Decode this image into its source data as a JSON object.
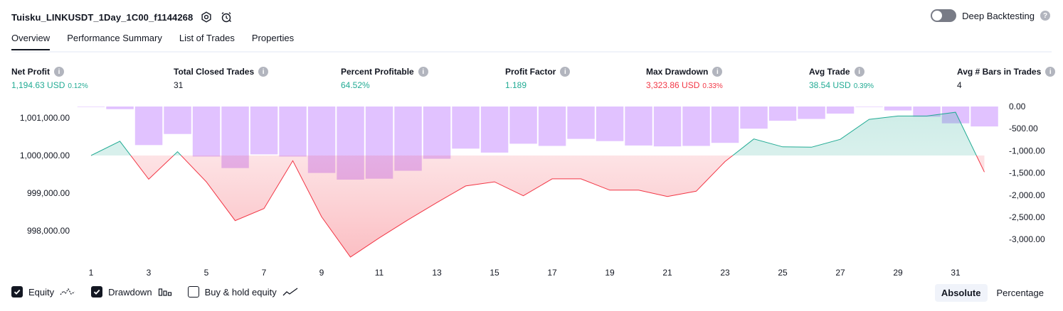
{
  "header": {
    "strategy_name": "Tuisku_LINKUSDT_1Day_1C00_f1144268",
    "deep_backtesting_label": "Deep Backtesting"
  },
  "tabs": [
    {
      "label": "Overview"
    },
    {
      "label": "Performance Summary"
    },
    {
      "label": "List of Trades"
    },
    {
      "label": "Properties"
    }
  ],
  "metrics": {
    "net_profit": {
      "label": "Net Profit",
      "value": "1,194.63 USD",
      "pct": "0.12%"
    },
    "total_closed_trades": {
      "label": "Total Closed Trades",
      "value": "31"
    },
    "percent_profitable": {
      "label": "Percent Profitable",
      "value": "64.52%"
    },
    "profit_factor": {
      "label": "Profit Factor",
      "value": "1.189"
    },
    "max_drawdown": {
      "label": "Max Drawdown",
      "value": "3,323.86 USD",
      "pct": "0.33%"
    },
    "avg_trade": {
      "label": "Avg Trade",
      "value": "38.54 USD",
      "pct": "0.39%"
    },
    "avg_bars": {
      "label": "Avg # Bars in Trades",
      "value": "4"
    }
  },
  "colors": {
    "positive": "#22ab94",
    "negative": "#f23645",
    "drawdown_bar": "#e1c2ff",
    "equity_line_up": "#22ab94",
    "equity_line_down": "#f23645"
  },
  "chart_data": {
    "type": "line",
    "left_axis": {
      "ticks": [
        1001000,
        1000000,
        999000,
        998000
      ],
      "tick_labels": [
        "1,001,000.00",
        "1,000,000.00",
        "999,000.00",
        "998,000.00"
      ]
    },
    "right_axis": {
      "ticks": [
        0,
        -500,
        -1000,
        -1500,
        -2000,
        -2500,
        -3000
      ],
      "tick_labels": [
        "0.00",
        "-500.00",
        "-1,000.00",
        "-1,500.00",
        "-2,000.00",
        "-2,500.00",
        "-3,000.00"
      ]
    },
    "x_tick_labels": [
      "1",
      "3",
      "5",
      "7",
      "9",
      "11",
      "13",
      "15",
      "17",
      "19",
      "21",
      "23",
      "25",
      "27",
      "29",
      "31"
    ],
    "baseline_equity": 1000000,
    "equity": {
      "trades": [
        1,
        2,
        3,
        4,
        5,
        6,
        7,
        8,
        9,
        10,
        11,
        12,
        13,
        14,
        15,
        16,
        17,
        18,
        19,
        20,
        21,
        22,
        23,
        24,
        25,
        26,
        27,
        28,
        29,
        30,
        31,
        32
      ],
      "values": [
        1000000,
        1000380,
        999370,
        1000100,
        999300,
        998270,
        998590,
        999860,
        998370,
        997300,
        997810,
        998290,
        998750,
        999190,
        999300,
        998930,
        999380,
        999380,
        999080,
        999080,
        998910,
        999050,
        999840,
        1000440,
        1000230,
        1000220,
        1000430,
        1000960,
        1001050,
        1001050,
        1001150,
        999560
      ]
    },
    "drawdown": {
      "trades": [
        1,
        2,
        3,
        4,
        5,
        6,
        7,
        8,
        9,
        10,
        11,
        12,
        13,
        14,
        15,
        16,
        17,
        18,
        19,
        20,
        21,
        22,
        23,
        24,
        25,
        26,
        27,
        28,
        29,
        30,
        31,
        32
      ],
      "values": [
        -10,
        -60,
        -870,
        -620,
        -1130,
        -1390,
        -1080,
        -1130,
        -1500,
        -1650,
        -1630,
        -1450,
        -1180,
        -950,
        -1040,
        -840,
        -890,
        -730,
        -780,
        -880,
        -900,
        -890,
        -820,
        -500,
        -320,
        -280,
        -160,
        -10,
        -90,
        -230,
        -380,
        -450
      ]
    },
    "legend": [
      {
        "label": "Equity",
        "checked": true
      },
      {
        "label": "Drawdown",
        "checked": true
      },
      {
        "label": "Buy & hold equity",
        "checked": false
      }
    ]
  },
  "view_toggle": {
    "absolute_label": "Absolute",
    "percentage_label": "Percentage",
    "selected": "Absolute"
  }
}
